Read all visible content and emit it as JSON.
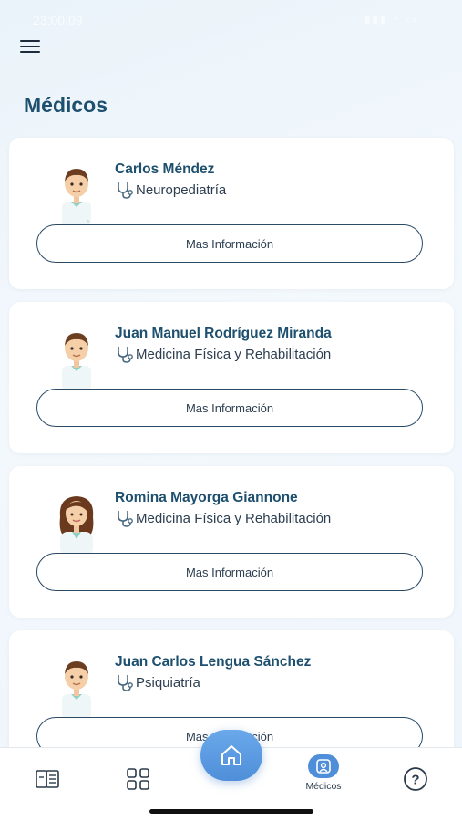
{
  "status_bar": {
    "time": "23:00:09",
    "indicators": ""
  },
  "header": {
    "menu_icon": "hamburger-menu-icon",
    "title": "Médicos"
  },
  "doctors": [
    {
      "name": "Carlos Méndez",
      "specialty": "Neuropediatría",
      "avatar": "male-doctor-avatar",
      "button_label": "Mas Información"
    },
    {
      "name": "Juan Manuel Rodríguez Miranda",
      "specialty": "Medicina Física y Rehabilitación",
      "avatar": "male-doctor-avatar",
      "button_label": "Mas Información"
    },
    {
      "name": "Romina Mayorga Giannone",
      "specialty": "Medicina Física y Rehabilitación",
      "avatar": "female-doctor-avatar",
      "button_label": "Mas Información"
    },
    {
      "name": "Juan Carlos Lengua Sánchez",
      "specialty": "Psiquiatría",
      "avatar": "male-doctor-avatar",
      "button_label": "Mas Información"
    }
  ],
  "bottom_nav": {
    "items": [
      {
        "icon": "documents-icon",
        "label": ""
      },
      {
        "icon": "grid-icon",
        "label": ""
      },
      {
        "icon": "home-icon",
        "label": ""
      },
      {
        "icon": "doctor-icon",
        "label": "Médicos",
        "active": true
      },
      {
        "icon": "help-icon",
        "label": ""
      }
    ]
  },
  "colors": {
    "title": "#1d4f6e",
    "accent": "#4f8fd9",
    "card_bg": "#ffffff",
    "button_border": "#2a4a66"
  }
}
